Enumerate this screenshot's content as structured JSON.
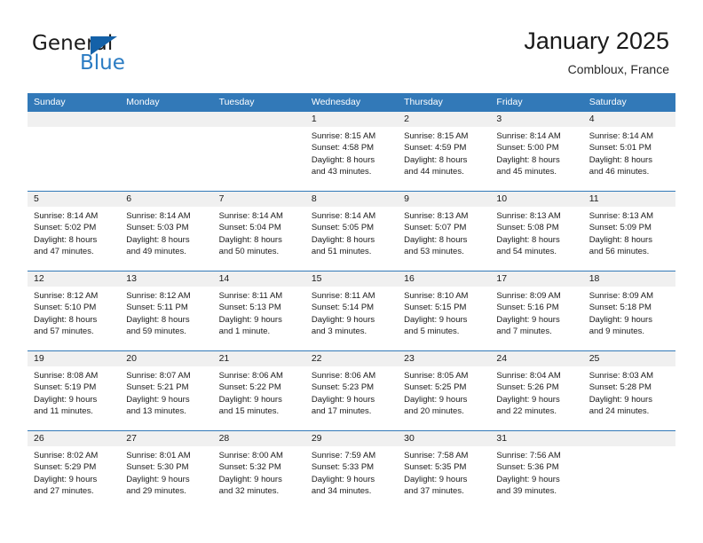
{
  "brand": {
    "name_part1": "General",
    "name_part2": "Blue",
    "triangle_icon": "brand-triangle-icon",
    "accent_color": "#2b7cc3",
    "triangle_color": "#1461a8"
  },
  "header": {
    "title": "January 2025",
    "location": "Combloux, France"
  },
  "theme": {
    "header_row_color": "#3279b8",
    "day_header_bg": "#f0f0f0",
    "separator_color": "#3279b8"
  },
  "weekdays": [
    "Sunday",
    "Monday",
    "Tuesday",
    "Wednesday",
    "Thursday",
    "Friday",
    "Saturday"
  ],
  "weeks": [
    [
      {
        "date": "",
        "empty": true,
        "sunrise": "",
        "sunset": "",
        "daylight_line1": "",
        "daylight_line2": ""
      },
      {
        "date": "",
        "empty": true,
        "sunrise": "",
        "sunset": "",
        "daylight_line1": "",
        "daylight_line2": ""
      },
      {
        "date": "",
        "empty": true,
        "sunrise": "",
        "sunset": "",
        "daylight_line1": "",
        "daylight_line2": ""
      },
      {
        "date": "1",
        "empty": false,
        "sunrise": "Sunrise: 8:15 AM",
        "sunset": "Sunset: 4:58 PM",
        "daylight_line1": "Daylight: 8 hours",
        "daylight_line2": "and 43 minutes."
      },
      {
        "date": "2",
        "empty": false,
        "sunrise": "Sunrise: 8:15 AM",
        "sunset": "Sunset: 4:59 PM",
        "daylight_line1": "Daylight: 8 hours",
        "daylight_line2": "and 44 minutes."
      },
      {
        "date": "3",
        "empty": false,
        "sunrise": "Sunrise: 8:14 AM",
        "sunset": "Sunset: 5:00 PM",
        "daylight_line1": "Daylight: 8 hours",
        "daylight_line2": "and 45 minutes."
      },
      {
        "date": "4",
        "empty": false,
        "sunrise": "Sunrise: 8:14 AM",
        "sunset": "Sunset: 5:01 PM",
        "daylight_line1": "Daylight: 8 hours",
        "daylight_line2": "and 46 minutes."
      }
    ],
    [
      {
        "date": "5",
        "empty": false,
        "sunrise": "Sunrise: 8:14 AM",
        "sunset": "Sunset: 5:02 PM",
        "daylight_line1": "Daylight: 8 hours",
        "daylight_line2": "and 47 minutes."
      },
      {
        "date": "6",
        "empty": false,
        "sunrise": "Sunrise: 8:14 AM",
        "sunset": "Sunset: 5:03 PM",
        "daylight_line1": "Daylight: 8 hours",
        "daylight_line2": "and 49 minutes."
      },
      {
        "date": "7",
        "empty": false,
        "sunrise": "Sunrise: 8:14 AM",
        "sunset": "Sunset: 5:04 PM",
        "daylight_line1": "Daylight: 8 hours",
        "daylight_line2": "and 50 minutes."
      },
      {
        "date": "8",
        "empty": false,
        "sunrise": "Sunrise: 8:14 AM",
        "sunset": "Sunset: 5:05 PM",
        "daylight_line1": "Daylight: 8 hours",
        "daylight_line2": "and 51 minutes."
      },
      {
        "date": "9",
        "empty": false,
        "sunrise": "Sunrise: 8:13 AM",
        "sunset": "Sunset: 5:07 PM",
        "daylight_line1": "Daylight: 8 hours",
        "daylight_line2": "and 53 minutes."
      },
      {
        "date": "10",
        "empty": false,
        "sunrise": "Sunrise: 8:13 AM",
        "sunset": "Sunset: 5:08 PM",
        "daylight_line1": "Daylight: 8 hours",
        "daylight_line2": "and 54 minutes."
      },
      {
        "date": "11",
        "empty": false,
        "sunrise": "Sunrise: 8:13 AM",
        "sunset": "Sunset: 5:09 PM",
        "daylight_line1": "Daylight: 8 hours",
        "daylight_line2": "and 56 minutes."
      }
    ],
    [
      {
        "date": "12",
        "empty": false,
        "sunrise": "Sunrise: 8:12 AM",
        "sunset": "Sunset: 5:10 PM",
        "daylight_line1": "Daylight: 8 hours",
        "daylight_line2": "and 57 minutes."
      },
      {
        "date": "13",
        "empty": false,
        "sunrise": "Sunrise: 8:12 AM",
        "sunset": "Sunset: 5:11 PM",
        "daylight_line1": "Daylight: 8 hours",
        "daylight_line2": "and 59 minutes."
      },
      {
        "date": "14",
        "empty": false,
        "sunrise": "Sunrise: 8:11 AM",
        "sunset": "Sunset: 5:13 PM",
        "daylight_line1": "Daylight: 9 hours",
        "daylight_line2": "and 1 minute."
      },
      {
        "date": "15",
        "empty": false,
        "sunrise": "Sunrise: 8:11 AM",
        "sunset": "Sunset: 5:14 PM",
        "daylight_line1": "Daylight: 9 hours",
        "daylight_line2": "and 3 minutes."
      },
      {
        "date": "16",
        "empty": false,
        "sunrise": "Sunrise: 8:10 AM",
        "sunset": "Sunset: 5:15 PM",
        "daylight_line1": "Daylight: 9 hours",
        "daylight_line2": "and 5 minutes."
      },
      {
        "date": "17",
        "empty": false,
        "sunrise": "Sunrise: 8:09 AM",
        "sunset": "Sunset: 5:16 PM",
        "daylight_line1": "Daylight: 9 hours",
        "daylight_line2": "and 7 minutes."
      },
      {
        "date": "18",
        "empty": false,
        "sunrise": "Sunrise: 8:09 AM",
        "sunset": "Sunset: 5:18 PM",
        "daylight_line1": "Daylight: 9 hours",
        "daylight_line2": "and 9 minutes."
      }
    ],
    [
      {
        "date": "19",
        "empty": false,
        "sunrise": "Sunrise: 8:08 AM",
        "sunset": "Sunset: 5:19 PM",
        "daylight_line1": "Daylight: 9 hours",
        "daylight_line2": "and 11 minutes."
      },
      {
        "date": "20",
        "empty": false,
        "sunrise": "Sunrise: 8:07 AM",
        "sunset": "Sunset: 5:21 PM",
        "daylight_line1": "Daylight: 9 hours",
        "daylight_line2": "and 13 minutes."
      },
      {
        "date": "21",
        "empty": false,
        "sunrise": "Sunrise: 8:06 AM",
        "sunset": "Sunset: 5:22 PM",
        "daylight_line1": "Daylight: 9 hours",
        "daylight_line2": "and 15 minutes."
      },
      {
        "date": "22",
        "empty": false,
        "sunrise": "Sunrise: 8:06 AM",
        "sunset": "Sunset: 5:23 PM",
        "daylight_line1": "Daylight: 9 hours",
        "daylight_line2": "and 17 minutes."
      },
      {
        "date": "23",
        "empty": false,
        "sunrise": "Sunrise: 8:05 AM",
        "sunset": "Sunset: 5:25 PM",
        "daylight_line1": "Daylight: 9 hours",
        "daylight_line2": "and 20 minutes."
      },
      {
        "date": "24",
        "empty": false,
        "sunrise": "Sunrise: 8:04 AM",
        "sunset": "Sunset: 5:26 PM",
        "daylight_line1": "Daylight: 9 hours",
        "daylight_line2": "and 22 minutes."
      },
      {
        "date": "25",
        "empty": false,
        "sunrise": "Sunrise: 8:03 AM",
        "sunset": "Sunset: 5:28 PM",
        "daylight_line1": "Daylight: 9 hours",
        "daylight_line2": "and 24 minutes."
      }
    ],
    [
      {
        "date": "26",
        "empty": false,
        "sunrise": "Sunrise: 8:02 AM",
        "sunset": "Sunset: 5:29 PM",
        "daylight_line1": "Daylight: 9 hours",
        "daylight_line2": "and 27 minutes."
      },
      {
        "date": "27",
        "empty": false,
        "sunrise": "Sunrise: 8:01 AM",
        "sunset": "Sunset: 5:30 PM",
        "daylight_line1": "Daylight: 9 hours",
        "daylight_line2": "and 29 minutes."
      },
      {
        "date": "28",
        "empty": false,
        "sunrise": "Sunrise: 8:00 AM",
        "sunset": "Sunset: 5:32 PM",
        "daylight_line1": "Daylight: 9 hours",
        "daylight_line2": "and 32 minutes."
      },
      {
        "date": "29",
        "empty": false,
        "sunrise": "Sunrise: 7:59 AM",
        "sunset": "Sunset: 5:33 PM",
        "daylight_line1": "Daylight: 9 hours",
        "daylight_line2": "and 34 minutes."
      },
      {
        "date": "30",
        "empty": false,
        "sunrise": "Sunrise: 7:58 AM",
        "sunset": "Sunset: 5:35 PM",
        "daylight_line1": "Daylight: 9 hours",
        "daylight_line2": "and 37 minutes."
      },
      {
        "date": "31",
        "empty": false,
        "sunrise": "Sunrise: 7:56 AM",
        "sunset": "Sunset: 5:36 PM",
        "daylight_line1": "Daylight: 9 hours",
        "daylight_line2": "and 39 minutes."
      },
      {
        "date": "",
        "empty": true,
        "sunrise": "",
        "sunset": "",
        "daylight_line1": "",
        "daylight_line2": ""
      }
    ]
  ]
}
